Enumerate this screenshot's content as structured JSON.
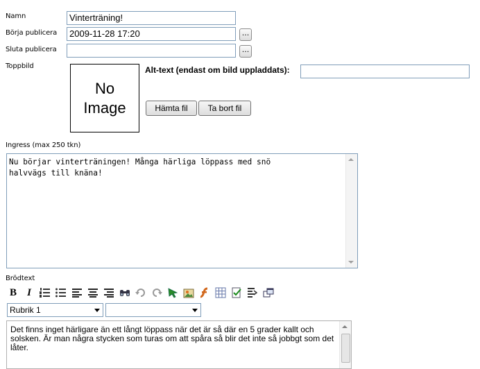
{
  "fields": {
    "namn": {
      "label": "Namn",
      "value": "Vinterträning!"
    },
    "borja": {
      "label": "Börja publicera",
      "value": "2009-11-28 17:20",
      "button": "..."
    },
    "sluta": {
      "label": "Sluta publicera",
      "value": "",
      "button": "..."
    }
  },
  "toppbild": {
    "label": "Toppbild",
    "noimage_line1": "No",
    "noimage_line2": "Image",
    "alt_label": "Alt-text (endast om bild uppladdats):",
    "alt_value": "",
    "fetch_button": "Hämta fil",
    "remove_button": "Ta bort fil"
  },
  "ingress": {
    "label": "Ingress (max 250 tkn)",
    "value": "Nu börjar vinterträningen! Många härliga löppass med snö\nhalvvägs till knäna!"
  },
  "brodtext": {
    "label": "Brödtext",
    "toolbar": [
      "bold-icon",
      "italic-icon",
      "numbered-list-icon",
      "bullet-list-icon",
      "align-left-icon",
      "align-center-icon",
      "align-right-icon",
      "find-icon",
      "undo-icon",
      "redo-icon",
      "insert-link-icon",
      "insert-image-icon",
      "insert-flash-icon",
      "insert-table-icon",
      "spellcheck-icon",
      "clean-format-icon",
      "toggle-view-icon"
    ],
    "format_select": "Rubrik 1",
    "style_select": "",
    "content": "Det finns inget härligare än ett långt löppass när det är så där en 5 grader kallt och solsken. Är man några stycken som turas om att spåra så blir det inte så jobbgt som det låter."
  }
}
